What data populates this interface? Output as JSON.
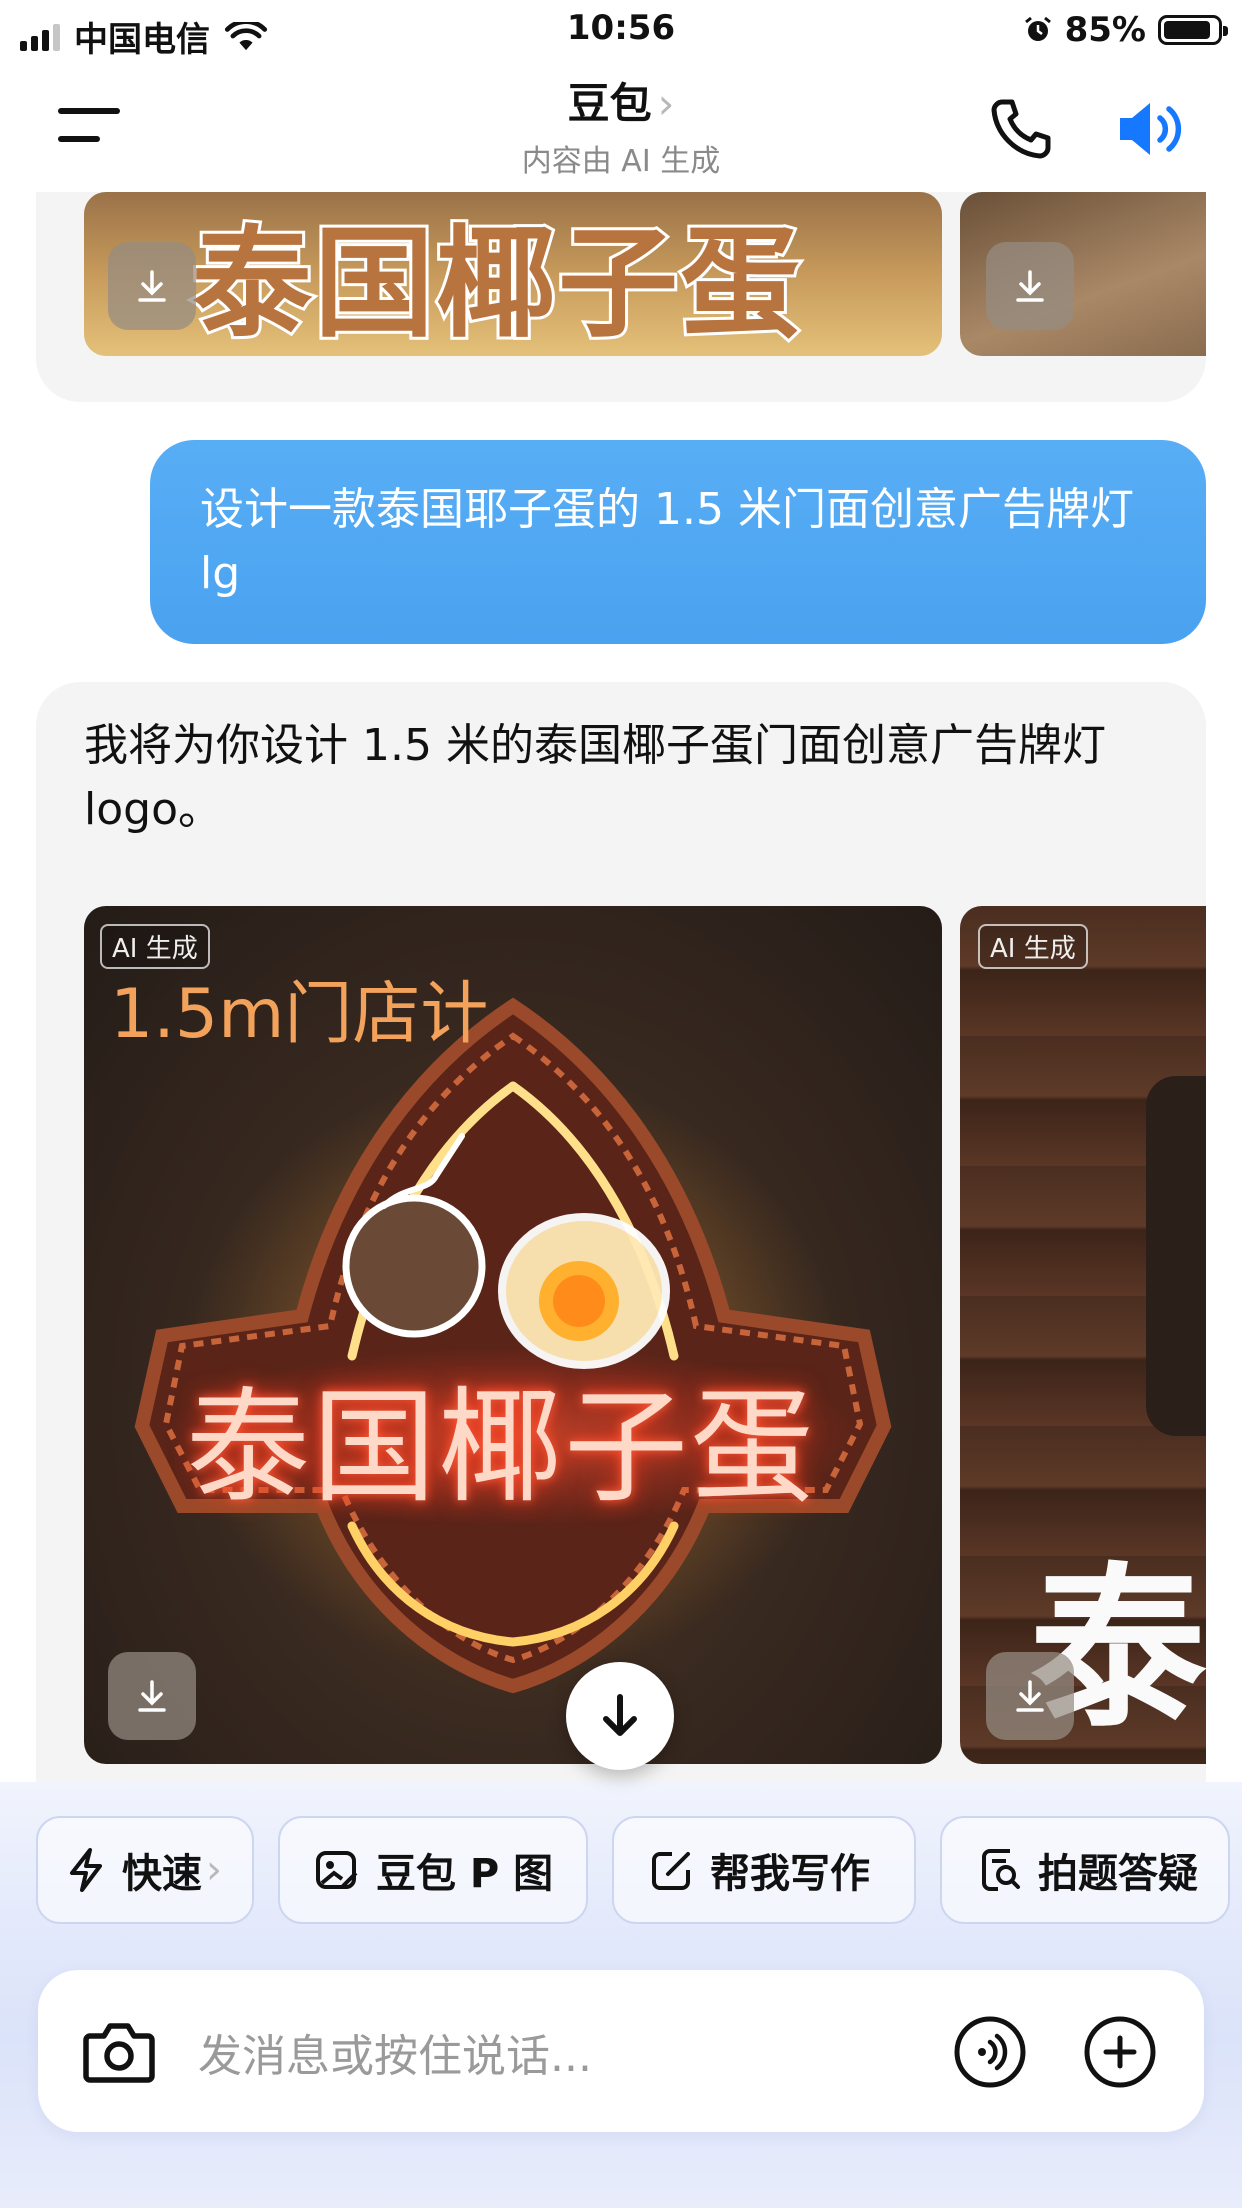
{
  "status_bar": {
    "carrier": "中国电信",
    "time": "10:56",
    "battery": "85%",
    "battery_level": 0.85
  },
  "header": {
    "title": "豆包",
    "title_chevron": "›",
    "subtitle": "内容由 AI 生成"
  },
  "top_card": {
    "image_text": "泰国椰子蛋"
  },
  "user_message": {
    "text": "设计一款泰国耶子蛋的 1.5 米门面创意广告牌灯 lg"
  },
  "ai_message": {
    "text": "我将为你设计 1.5 米的泰国椰子蛋门面创意广告牌灯 logo。",
    "images": [
      {
        "tag": "AI 生成",
        "caption": "1.5m门店计",
        "sign_text": "泰国椰子蛋"
      },
      {
        "tag": "AI 生成",
        "sign_text": "泰"
      }
    ]
  },
  "chips": [
    {
      "label": "快速",
      "icon": "lightning-icon",
      "chevron": "›"
    },
    {
      "label": "豆包 P 图",
      "icon": "image-edit-icon"
    },
    {
      "label": "帮我写作",
      "icon": "pen-square-icon"
    },
    {
      "label": "拍题答疑",
      "icon": "document-search-icon"
    }
  ],
  "composer": {
    "placeholder": "发消息或按住说话..."
  },
  "colors": {
    "accent_blue": "#4aa2f0",
    "speaker_blue": "#1677ff",
    "card_bg": "#f4f4f4"
  }
}
